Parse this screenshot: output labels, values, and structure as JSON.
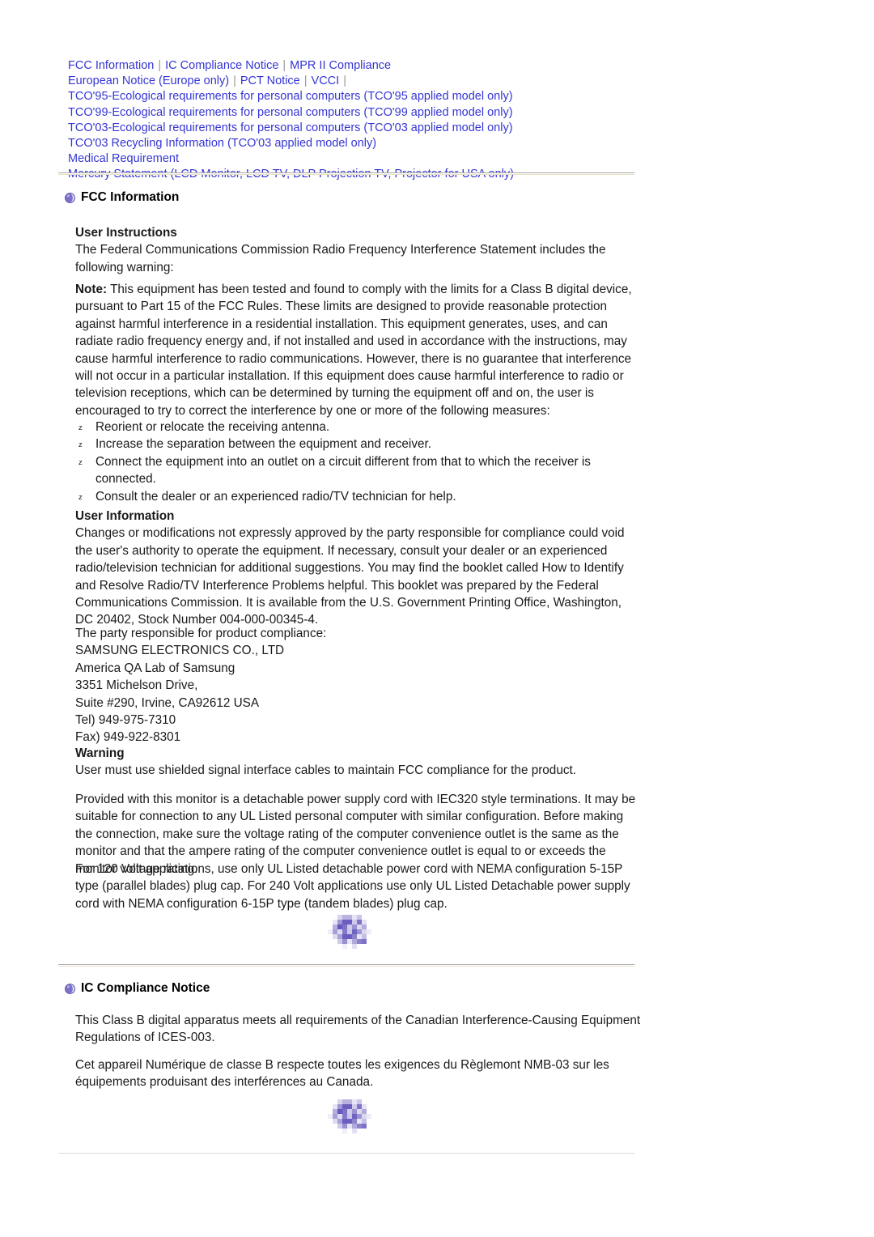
{
  "page": {
    "title": "FCC Information",
    "link_color": "#3535d4",
    "separator_color": "#9a9a9a",
    "bullet_color": "#7b73c9",
    "rule_color": "#a8a8a8",
    "rule_shadow_color": "#e8e0c4"
  },
  "nav": {
    "separator": "|",
    "rows": [
      {
        "links": [
          "FCC Information",
          "IC Compliance Notice",
          "MPR II Compliance"
        ],
        "trailing_separator": false
      },
      {
        "links": [
          "European Notice (Europe only)",
          "PCT Notice",
          "VCCI"
        ],
        "trailing_separator": true
      }
    ],
    "single_links": [
      "TCO'95-Ecological requirements for personal computers (TCO'95 applied model only)",
      "TCO'99-Ecological requirements for personal computers (TCO'99 applied model only)",
      "TCO'03-Ecological requirements for personal computers (TCO'03 applied model only)",
      "TCO'03 Recycling Information (TCO'03 applied model only)",
      "Medical Requirement",
      "Mercury Statement (LCD Monitor, LCD TV, DLP Projection TV, Projector for USA only)"
    ]
  },
  "fcc": {
    "heading": "FCC Information",
    "user_instructions_heading": "User Instructions",
    "user_instructions_body": "The Federal Communications Commission Radio Frequency Interference Statement includes the following warning:",
    "note_label": "Note:",
    "note_body": " This equipment has been tested and found to comply with the limits for a Class B digital device, pursuant to Part 15 of the FCC Rules. These limits are designed to provide reasonable protection against harmful interference in a residential installation. This equipment generates, uses, and can radiate radio frequency energy and, if not installed and used in accordance with the instructions, may cause harmful interference to radio communications. However, there is no guarantee that interference will not occur in a particular installation. If this equipment does cause harmful interference to radio or television receptions, which can be determined by turning the equipment off and on, the user is encouraged to try to correct the interference by one or more of the following measures:",
    "measures_bullet": "z",
    "measures": [
      "Reorient or relocate the receiving antenna.",
      "Increase the separation between the equipment and receiver.",
      "Connect the equipment into an outlet on a circuit different from that to which the receiver is connected.",
      "Consult the dealer or an experienced radio/TV technician for help."
    ],
    "user_information_heading": "User Information",
    "user_information_body": "Changes or modifications not expressly approved by the party responsible for compliance could void the user's authority to operate the equipment. If necessary, consult your dealer or an experienced radio/television technician for additional suggestions. You may find the booklet called How to Identify and Resolve Radio/TV Interference Problems helpful. This booklet was prepared by the Federal Communications Commission. It is available from the U.S. Government Printing Office, Washington, DC 20402, Stock Number 004-000-00345-4.",
    "responsible_party": [
      "The party responsible for product compliance:",
      "SAMSUNG ELECTRONICS CO., LTD",
      "America QA Lab of Samsung",
      "3351 Michelson Drive,",
      "Suite #290, Irvine, CA92612 USA",
      "Tel) 949-975-7310",
      "Fax) 949-922-8301"
    ],
    "warning_heading": "Warning",
    "warning_body": "User must use shielded signal interface cables to maintain FCC compliance for the product.",
    "power_cord_para": "Provided with this monitor is a detachable power supply cord with IEC320 style terminations. It may be suitable for connection to any UL Listed personal computer with similar configuration. Before making the connection, make sure the voltage rating of the computer convenience outlet is the same as the monitor and that the ampere rating of the computer convenience outlet is equal to or exceeds the monitor voltage rating.",
    "nema_para": "For 120 Volt applications, use only UL Listed detachable power cord with NEMA configuration 5-15P type (parallel blades) plug cap. For 240 Volt applications use only UL Listed Detachable power supply cord with NEMA configuration 6-15P type (tandem blades) plug cap."
  },
  "ic": {
    "heading": "IC Compliance Notice",
    "paragraph_en": "This Class B digital apparatus meets all requirements of the Canadian Interference-Causing Equipment Regulations of ICES-003.",
    "paragraph_fr": "Cet appareil Numérique de classe B respecte toutes les exigences du Règlemont NMB-03 sur les équipements produisant des interférences au Canada."
  },
  "graphics": {
    "top_link_alt": "back-to-top-graphic",
    "bottom_link_alt": "back-to-top-graphic"
  }
}
